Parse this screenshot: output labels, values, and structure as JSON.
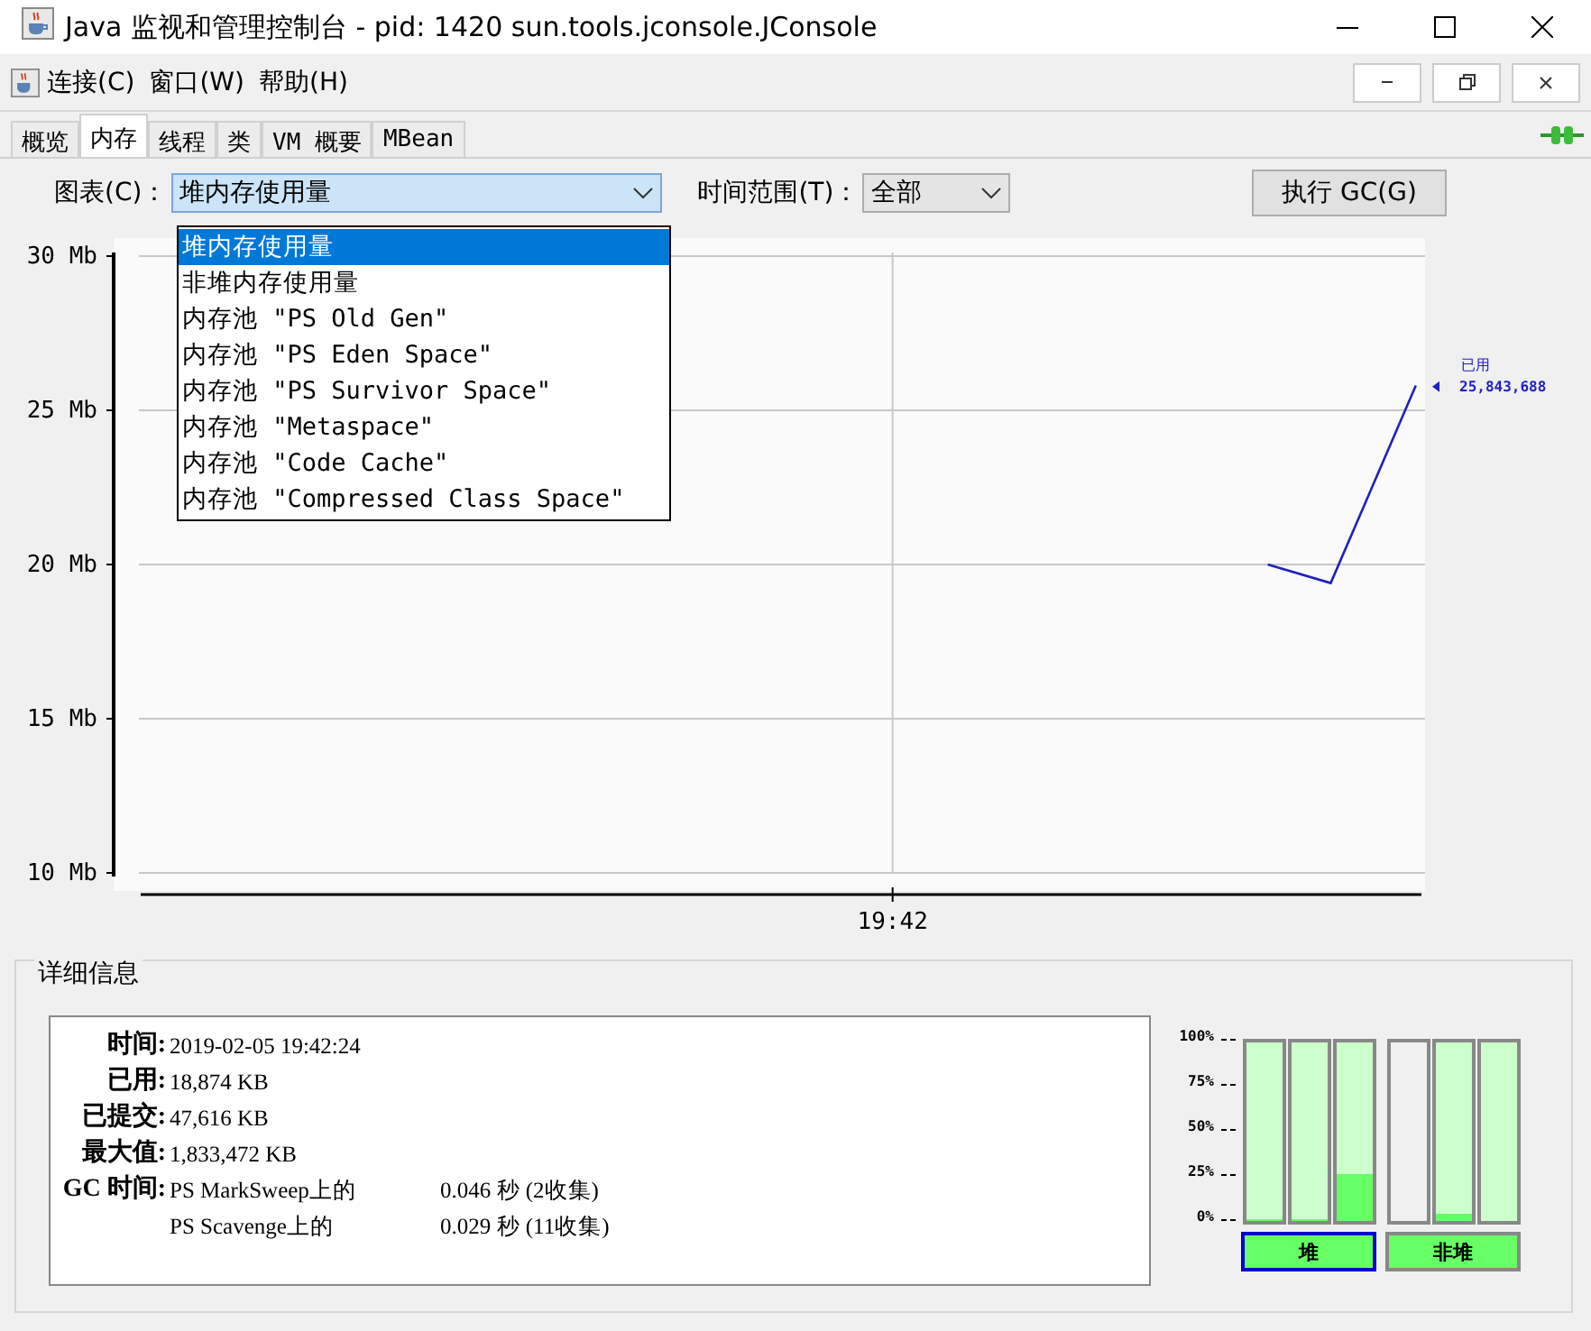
{
  "window": {
    "title": "Java 监视和管理控制台 - pid: 1420 sun.tools.jconsole.JConsole"
  },
  "menu": [
    "连接(C)",
    "窗口(W)",
    "帮助(H)"
  ],
  "tabs": [
    {
      "label": "概览",
      "selected": false
    },
    {
      "label": "内存",
      "selected": true
    },
    {
      "label": "线程",
      "selected": false
    },
    {
      "label": "类",
      "selected": false
    },
    {
      "label": "VM 概要",
      "selected": false
    },
    {
      "label": "MBean",
      "selected": false
    }
  ],
  "controls": {
    "chart_label": "图表(C)：",
    "chart_value": "堆内存使用量",
    "range_label": "时间范围(T)：",
    "range_value": "全部",
    "gc_button": "执行 GC(G)"
  },
  "chart_options": [
    {
      "label": "堆内存使用量",
      "selected": true
    },
    {
      "label": "非堆内存使用量",
      "selected": false
    },
    {
      "label": "内存池 \"PS Old Gen\"",
      "selected": false
    },
    {
      "label": "内存池 \"PS Eden Space\"",
      "selected": false
    },
    {
      "label": "内存池 \"PS Survivor Space\"",
      "selected": false
    },
    {
      "label": "内存池 \"Metaspace\"",
      "selected": false
    },
    {
      "label": "内存池 \"Code Cache\"",
      "selected": false
    },
    {
      "label": "内存池 \"Compressed Class Space\"",
      "selected": false
    }
  ],
  "chart": {
    "y_labels": [
      "30 Mb",
      "25 Mb",
      "20 Mb",
      "15 Mb",
      "10 Mb"
    ],
    "time_label": "19:42",
    "series_name": "已用",
    "current_reading": "25,843,688"
  },
  "details": {
    "title": "详细信息",
    "rows": [
      {
        "label": "时间:",
        "value": "2019-02-05 19:42:24"
      },
      {
        "label": "已用:",
        "value": "18,874 KB"
      },
      {
        "label": "已提交:",
        "value": "47,616 KB"
      },
      {
        "label": "最大值:",
        "value": "1,833,472 KB"
      }
    ],
    "gc_label": "GC 时间:",
    "gc": [
      {
        "collector": "PS MarkSweep上的",
        "time": "0.046 秒 (2收集)"
      },
      {
        "collector": "PS Scavenge上的",
        "time": "0.029 秒 (11收集)"
      }
    ]
  },
  "pools": {
    "scale": [
      "100%",
      "75%",
      "50%",
      "25%",
      "0%"
    ],
    "groups": [
      {
        "label": "堆",
        "selected": true,
        "bars": [
          {
            "committed": true,
            "level": 0.01
          },
          {
            "committed": true,
            "level": 0.01
          },
          {
            "committed": true,
            "level": 0.26
          }
        ]
      },
      {
        "label": "非堆",
        "selected": false,
        "bars": [
          {
            "committed": false,
            "level": 0
          },
          {
            "committed": true,
            "level": 0.04
          },
          {
            "committed": true,
            "level": 0
          }
        ]
      }
    ]
  }
}
